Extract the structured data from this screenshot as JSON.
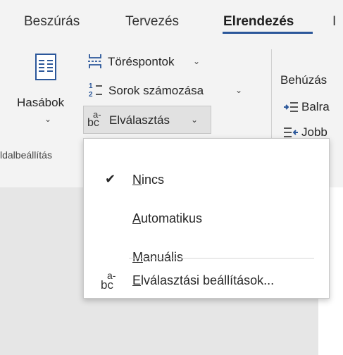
{
  "tabs": [
    "Beszúrás",
    "Tervezés",
    "Elrendezés",
    "I"
  ],
  "ribbon": {
    "columns_label": "Hasábok",
    "breaks_label": "Töréspontok",
    "line_numbers_label": "Sorok számozása",
    "hyphenation_label": "Elválasztás",
    "group_label": "ldalbeállítás",
    "indent_label": "Behúzás",
    "indent_left_label": "Balra",
    "indent_right_label": "Jobb"
  },
  "hyphen_icon": {
    "top": "a-",
    "bottom": "bc"
  },
  "menu": {
    "items": [
      {
        "first": "N",
        "rest": "incs",
        "checked": true
      },
      {
        "first": "A",
        "rest": "utomatikus",
        "checked": false
      },
      {
        "first": "M",
        "rest": "anuális",
        "checked": false
      }
    ],
    "options": {
      "first": "E",
      "rest": "lválasztási beállítások..."
    }
  },
  "colors": {
    "accent": "#2b579a",
    "icon_blue": "#2b579a",
    "ribbon_bg": "#f3f3f3",
    "doc_bg": "#e6e6e6"
  }
}
